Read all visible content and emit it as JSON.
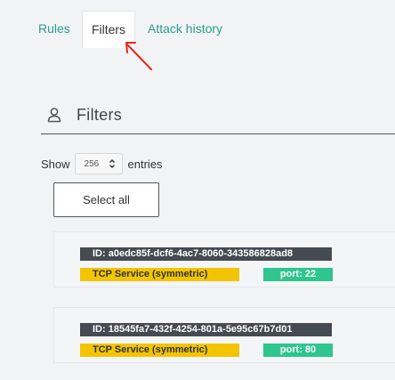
{
  "tabs": [
    {
      "label": "Rules"
    },
    {
      "label": "Filters"
    },
    {
      "label": "Attack history"
    }
  ],
  "section": {
    "title": "Filters",
    "icon": "user-icon"
  },
  "entries": {
    "show_label": "Show",
    "value": "256",
    "suffix_label": "entries"
  },
  "select_all_label": "Select all",
  "filters": [
    {
      "id_label": "ID: a0edc85f-dcf6-4ac7-8060-343586828ad8",
      "service": "TCP Service (symmetric)",
      "port": "port: 22"
    },
    {
      "id_label": "ID: 18545fa7-432f-4254-801a-5e95c67b7d01",
      "service": "TCP Service (symmetric)",
      "port": "port: 80"
    }
  ],
  "colors": {
    "tab_link": "#2a9d8f",
    "annotation_arrow": "#e0291c",
    "id_badge": "#454b53",
    "service_badge": "#f2c500",
    "port_badge": "#2ec58e"
  }
}
